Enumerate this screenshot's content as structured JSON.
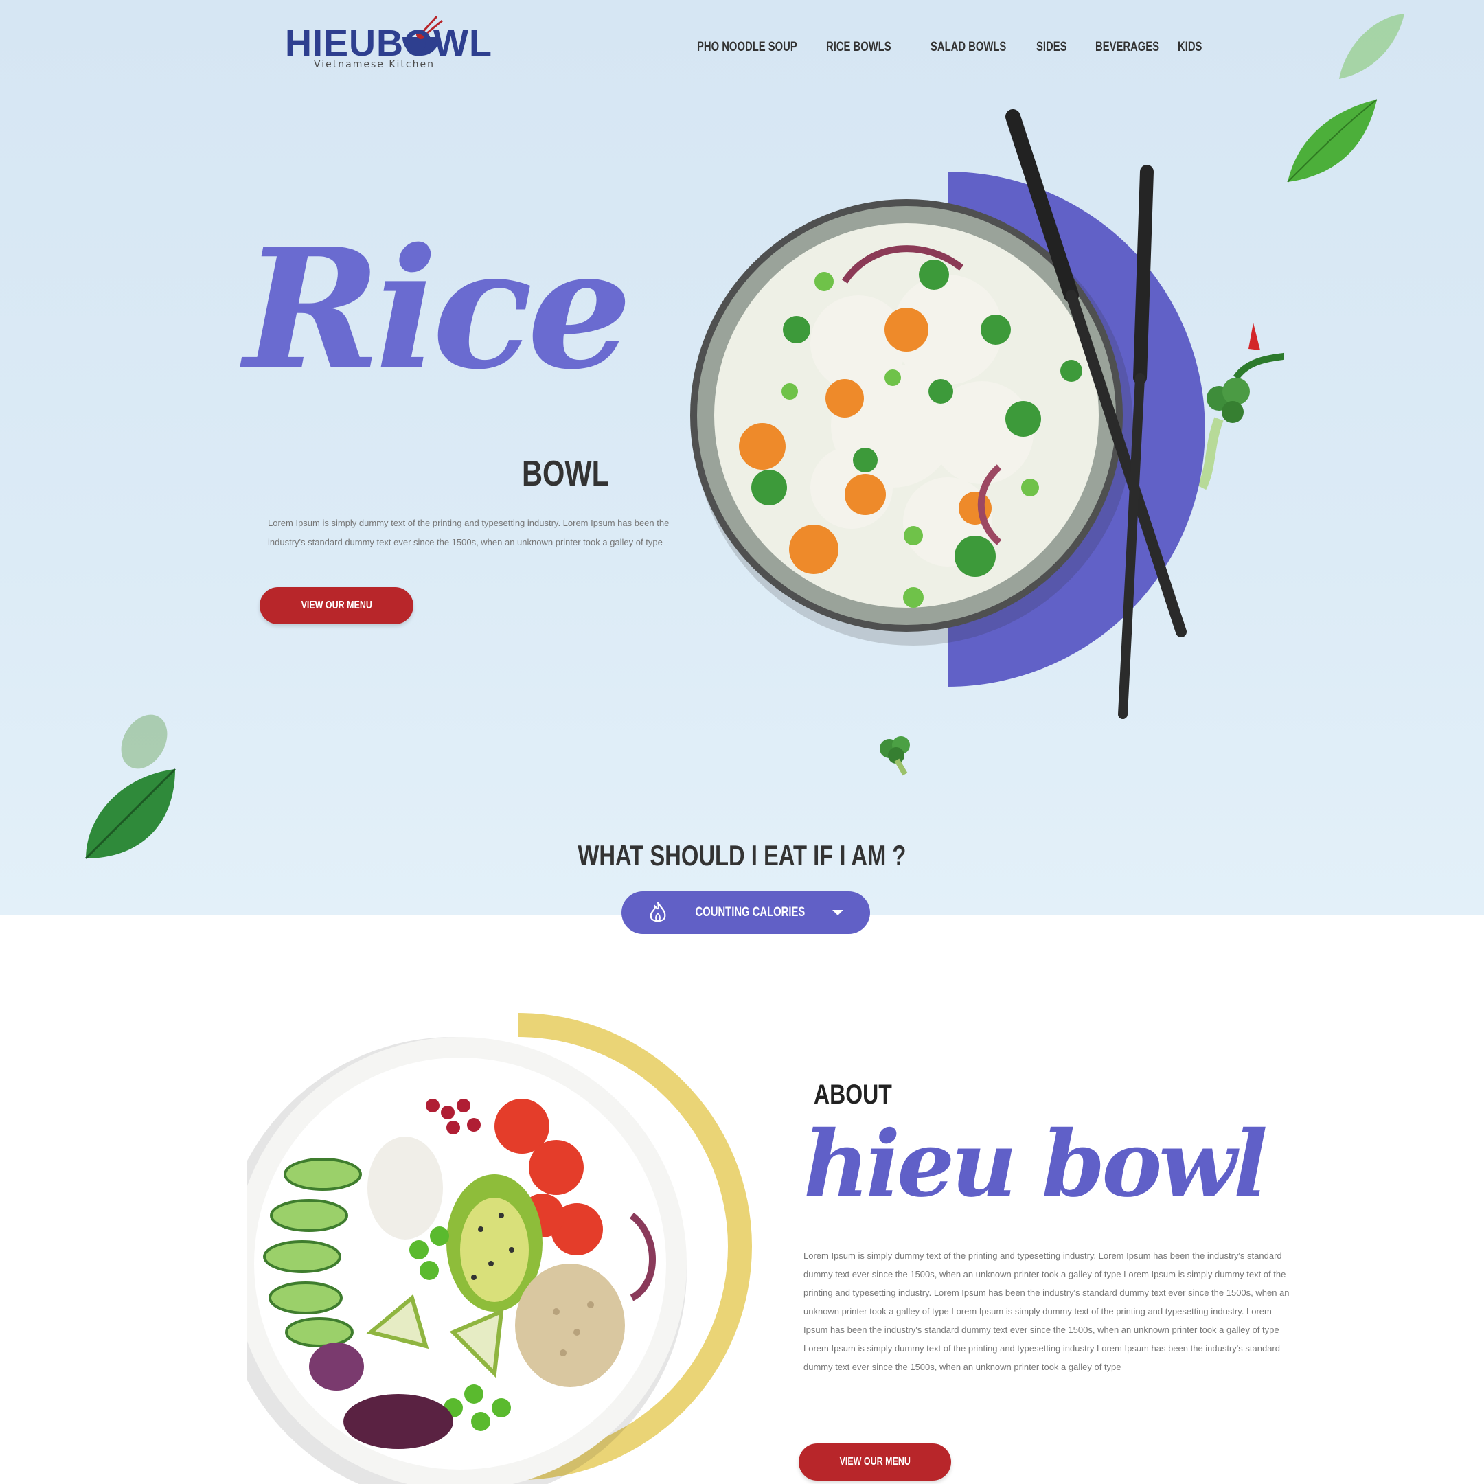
{
  "brand": {
    "name": "HIEUBOWL",
    "tagline": "Vietnamese Kitchen",
    "colors": {
      "navy": "#2e3f8f",
      "red": "#b8262a",
      "purple": "#6a6bd0",
      "yellow": "#ead476"
    }
  },
  "nav": {
    "items": [
      "PHO NOODLE SOUP",
      "RICE BOWLS",
      "SALAD BOWLS",
      "SIDES",
      "BEVERAGES",
      "KIDS"
    ]
  },
  "hero": {
    "script_title": "Rice",
    "subtitle": "BOWL",
    "description": "Lorem Ipsum is simply dummy text of the printing and typesetting industry. Lorem Ipsum has been the industry's standard dummy text ever since the 1500s, when an unknown printer took a galley of type",
    "button_label": "VIEW OUR MENU"
  },
  "question": {
    "heading": "WHAT SHOULD I EAT  IF I AM ?",
    "dropdown_label": "COUNTING CALORIES",
    "dropdown_icon": "flame-icon"
  },
  "about": {
    "heading": "ABOUT",
    "script_title": "hieu bowl",
    "description": "Lorem Ipsum is simply dummy text of the printing and typesetting industry. Lorem Ipsum has been the industry's standard dummy text ever since the 1500s, when an unknown printer took a galley of type Lorem Ipsum is simply dummy text of the printing and typesetting industry. Lorem Ipsum has been the industry's standard dummy text ever since the 1500s, when an unknown printer took a galley of type Lorem Ipsum is simply dummy text of the printing and typesetting industry. Lorem Ipsum has been the industry's standard dummy text ever since the 1500s, when an unknown printer took a galley of type Lorem Ipsum is simply dummy text of the printing and typesetting industry Lorem Ipsum has been the industry's standard dummy text ever since the 1500s, when an unknown printer took a galley of type",
    "button_label": "VIEW OUR MENU"
  }
}
